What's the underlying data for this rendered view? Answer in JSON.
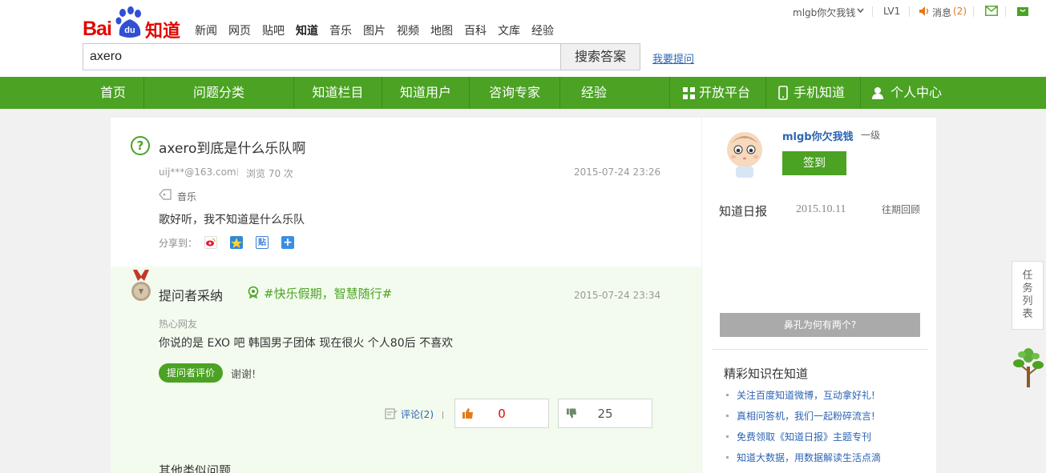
{
  "header": {
    "logo_text": "Bai",
    "logo_du": "du",
    "logo_product": "知道",
    "nav": [
      "新闻",
      "网页",
      "贴吧",
      "知道",
      "音乐",
      "图片",
      "视频",
      "地图",
      "百科",
      "文库",
      "经验"
    ],
    "active_nav": "知道",
    "search_value": "axero",
    "search_button": "搜索答案",
    "ask_link": "我要提问",
    "user": {
      "name": "mlgb你欠我钱",
      "level": "LV1",
      "messages_label": "消息",
      "messages_count": "(2)"
    }
  },
  "green_nav": {
    "items": [
      "首页",
      "问题分类",
      "知道栏目",
      "知道用户",
      "咨询专家",
      "经验"
    ],
    "right_items": [
      "开放平台",
      "手机知道",
      "个人中心"
    ]
  },
  "question": {
    "title": "axero到底是什么乐队啊",
    "asker": "uij***@163.com",
    "views": "浏览 70 次",
    "date": "2015-07-24 23:26",
    "tag": "音乐",
    "body": "歌好听，我不知道是什么乐队",
    "share_label": "分享到："
  },
  "answer": {
    "title": "提问者采纳",
    "promo": "#快乐假期，智慧随行#",
    "date": "2015-07-24 23:34",
    "author": "热心网友",
    "body": "你说的是  EXO 吧  韩国男子团体  现在很火   个人80后  不喜欢",
    "eval_button": "提问者评价",
    "eval_text": "谢谢!",
    "comment": "评论(2)",
    "up_votes": "0",
    "down_votes": "25",
    "other_title": "其他类似问题"
  },
  "sidebar": {
    "user_name": "mlgb你欠我钱",
    "user_level": "一级",
    "sign_button": "签到",
    "daily_title": "知道日报",
    "daily_date": "2015.10.11",
    "daily_past": "往期回顾",
    "daily_headline": "鼻孔为何有两个?",
    "featured_title": "精彩知识在知道",
    "featured_items": [
      "关注百度知道微博，互动拿好礼!",
      "真相问答机，我们一起粉碎流言!",
      "免费领取《知道日报》主题专刊",
      "知道大数据，用数据解读生活点滴"
    ]
  },
  "task_panel": "任务列表",
  "colors": {
    "brand_green": "#4ba223",
    "baidu_red": "#e10602",
    "link_blue": "#2d64b3",
    "vote_up": "#e10602"
  }
}
